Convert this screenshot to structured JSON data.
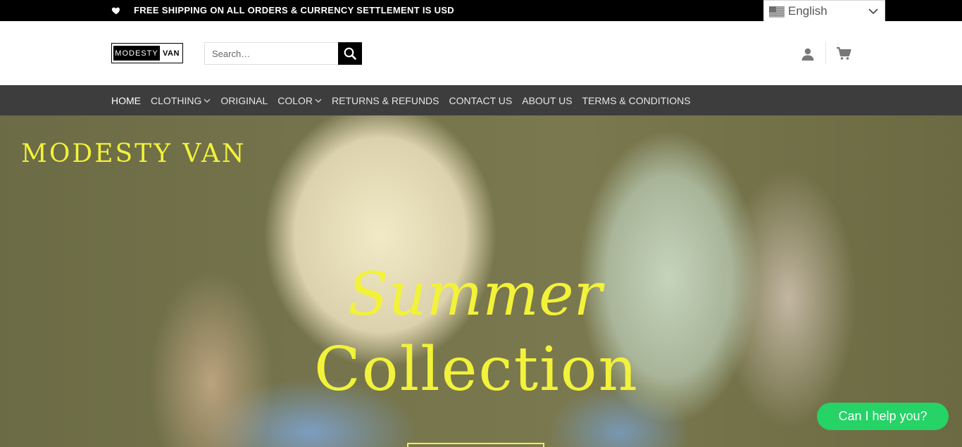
{
  "topbar": {
    "promo": "FREE SHIPPING ON ALL ORDERS & CURRENCY SETTLEMENT IS USD",
    "icon": "heart-icon",
    "language": {
      "label": "English",
      "flag": "us-flag-icon"
    }
  },
  "header": {
    "logo": {
      "left": "MODESTY",
      "right": "VAN"
    },
    "search": {
      "placeholder": "Search…",
      "button_icon": "search-icon"
    },
    "account_icon": "user-icon",
    "cart_icon": "cart-icon"
  },
  "nav": {
    "items": [
      {
        "label": "HOME",
        "active": true
      },
      {
        "label": "CLOTHING",
        "dropdown": true
      },
      {
        "label": "ORIGINAL"
      },
      {
        "label": "COLOR",
        "dropdown": true
      },
      {
        "label": "RETURNS & REFUNDS"
      },
      {
        "label": "CONTACT US"
      },
      {
        "label": "ABOUT US"
      },
      {
        "label": "TERMS & CONDITIONS"
      }
    ]
  },
  "hero": {
    "brand": "MODESTY VAN",
    "title_line1": "Summer",
    "title_line2": "Collection",
    "accent_color": "#f2f23a"
  },
  "chat": {
    "label": "Can I help you?",
    "color": "#25d366"
  }
}
